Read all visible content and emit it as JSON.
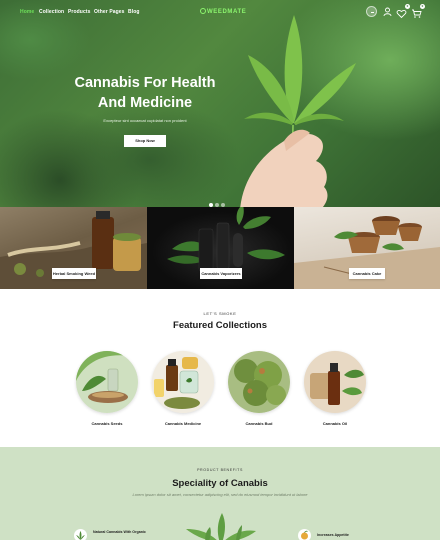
{
  "nav": {
    "links": [
      "Home",
      "Collection",
      "Products",
      "Other Pages",
      "Blog"
    ],
    "logo": "WEEDMATE",
    "wishlist_count": "0",
    "cart_count": "0"
  },
  "hero": {
    "title": "Cannabis For Health And Medicine",
    "subtitle": "Excepteur sint occaecat cupidatat non proident",
    "button": "Shop Now"
  },
  "tiles": [
    "Herbal Smoking Weed",
    "Cannabis Vaporizers",
    "Cannabis Cake"
  ],
  "featured": {
    "eyebrow": "LET'S SMOKE",
    "title": "Featured Collections",
    "items": [
      "Cannabis Seeds",
      "Cannabis Medicine",
      "Cannabis Bud",
      "Cannabis Oil"
    ]
  },
  "benefits": {
    "eyebrow": "PRODUCT BENEFITS",
    "title": "Speciality of Canabis",
    "subtitle": "Lorem ipsum dolor sit amet, consectetur adipiscing elit, sed do eiusmod tempor incididunt ut labore",
    "items": [
      "Natural Cannabis With Organic",
      "Increases Appetite"
    ]
  },
  "colors": {
    "accent": "#6ee05a",
    "benefits_bg": "#cfe1c5"
  }
}
